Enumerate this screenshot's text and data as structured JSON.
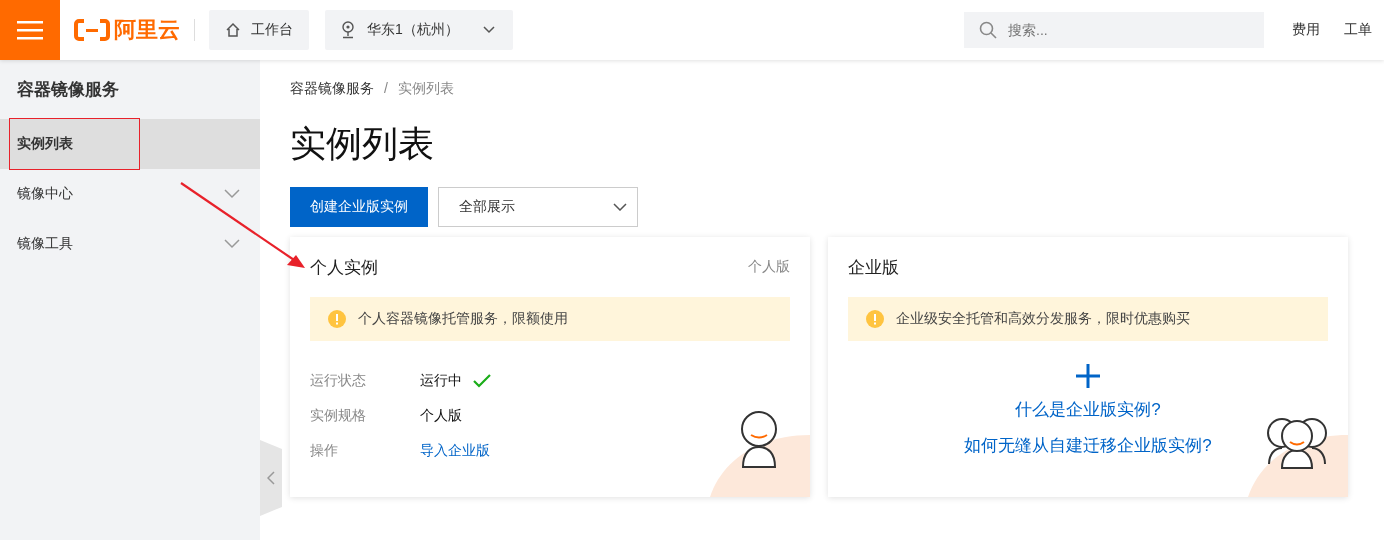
{
  "header": {
    "logo_text": "阿里云",
    "workbench": "工作台",
    "region": "华东1（杭州）",
    "search": {
      "placeholder": "搜索..."
    },
    "links": [
      "费用",
      "工单"
    ]
  },
  "sidebar": {
    "title": "容器镜像服务",
    "items": [
      {
        "label": "实例列表",
        "selected": true,
        "kind": "link"
      },
      {
        "label": "镜像中心",
        "selected": false,
        "kind": "group"
      },
      {
        "label": "镜像工具",
        "selected": false,
        "kind": "group"
      }
    ]
  },
  "breadcrumb": {
    "items": [
      "容器镜像服务",
      "实例列表"
    ],
    "separator": "/"
  },
  "page_title": "实例列表",
  "create_button": "创建企业版实例",
  "filter": {
    "value": "全部展示"
  },
  "cards": [
    {
      "kind": "personal",
      "title": "个人实例",
      "badge": "个人版",
      "notice": "个人容器镜像托管服务，限额使用",
      "fields": [
        {
          "label": "运行状态",
          "value": "运行中",
          "kind": "status"
        },
        {
          "label": "实例规格",
          "value": "个人版",
          "kind": "text"
        },
        {
          "label": "操作",
          "value": "导入企业版",
          "kind": "link"
        }
      ]
    },
    {
      "kind": "enterprise",
      "title": "企业版",
      "notice": "企业级安全托管和高效分发服务，限时优惠购买",
      "links": [
        "什么是企业版实例?",
        "如何无缝从自建迁移企业版实例?"
      ]
    }
  ]
}
